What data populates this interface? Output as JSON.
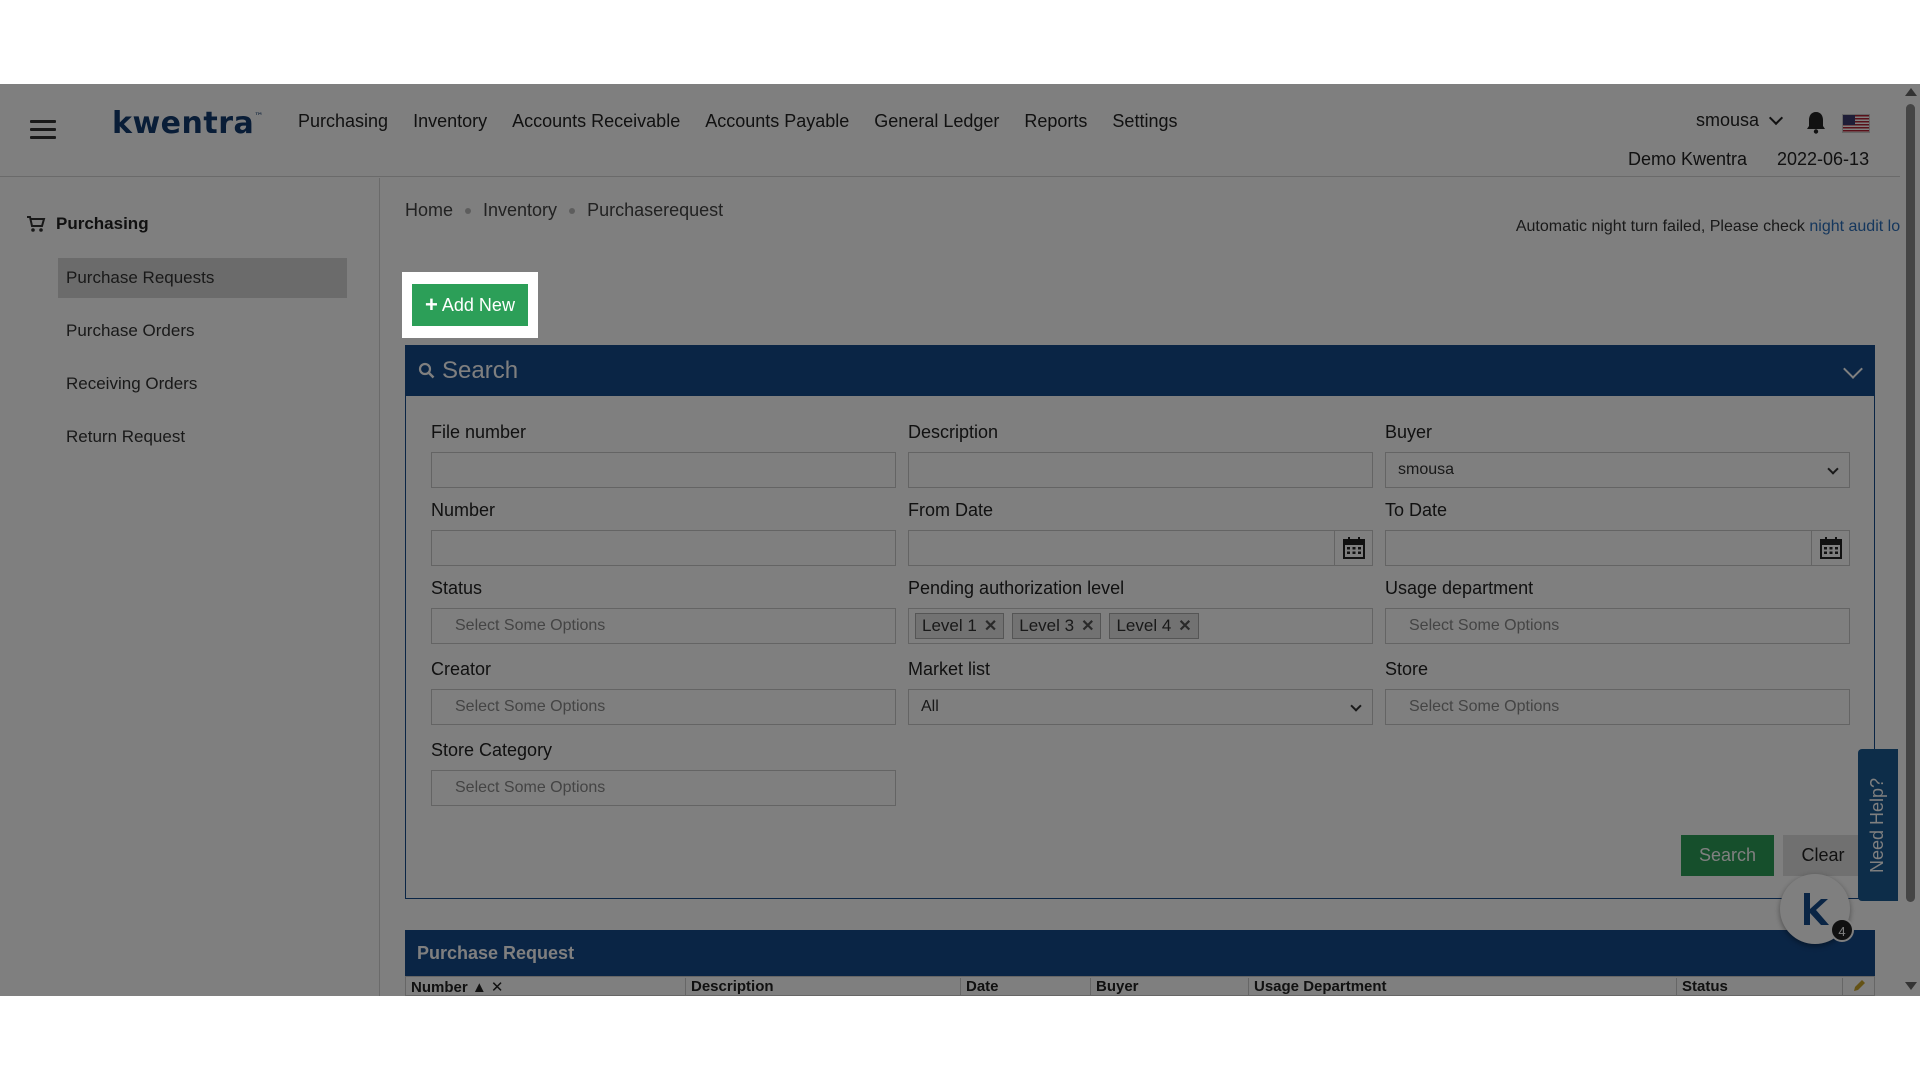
{
  "header": {
    "logo": "kwentra",
    "logo_tm": "™",
    "nav": [
      "Purchasing",
      "Inventory",
      "Accounts Receivable",
      "Accounts Payable",
      "General Ledger",
      "Reports",
      "Settings"
    ],
    "username": "smousa",
    "company": "Demo Kwentra",
    "date": "2022-06-13"
  },
  "sidebar": {
    "section": "Purchasing",
    "items": [
      {
        "label": "Purchase Requests",
        "active": true
      },
      {
        "label": "Purchase Orders",
        "active": false
      },
      {
        "label": "Receiving Orders",
        "active": false
      },
      {
        "label": "Return Request",
        "active": false
      }
    ]
  },
  "breadcrumb": [
    "Home",
    "Inventory",
    "Purchaserequest"
  ],
  "notice": {
    "text": "Automatic night turn failed, Please check ",
    "link": "night audit log"
  },
  "add_new": {
    "plus": "+",
    "label": "Add New"
  },
  "search": {
    "title": "Search",
    "fields": {
      "file_number": {
        "label": "File number",
        "value": ""
      },
      "description": {
        "label": "Description",
        "value": ""
      },
      "buyer": {
        "label": "Buyer",
        "value": "smousa"
      },
      "number": {
        "label": "Number",
        "value": ""
      },
      "from_date": {
        "label": "From Date",
        "value": ""
      },
      "to_date": {
        "label": "To Date",
        "value": ""
      },
      "status": {
        "label": "Status",
        "placeholder": "Select Some Options"
      },
      "pending_level": {
        "label": "Pending authorization level",
        "tags": [
          "Level 1",
          "Level 3",
          "Level 4"
        ]
      },
      "usage_department": {
        "label": "Usage department",
        "placeholder": "Select Some Options"
      },
      "creator": {
        "label": "Creator",
        "placeholder": "Select Some Options"
      },
      "market_list": {
        "label": "Market list",
        "value": "All"
      },
      "store": {
        "label": "Store",
        "placeholder": "Select Some Options"
      },
      "store_category": {
        "label": "Store Category",
        "placeholder": "Select Some Options"
      }
    },
    "search_button": "Search",
    "clear_button": "Clear"
  },
  "results": {
    "title": "Purchase Request",
    "columns": [
      "Number ▲ ✕",
      "Description",
      "Date",
      "Buyer",
      "Usage Department",
      "Status"
    ]
  },
  "help": {
    "label": "Need Help?",
    "badge": "4",
    "bubble_letter": "k"
  },
  "colors": {
    "primary": "#154a8a",
    "accent_green": "#2c9f58",
    "brand": "#123a6e"
  }
}
